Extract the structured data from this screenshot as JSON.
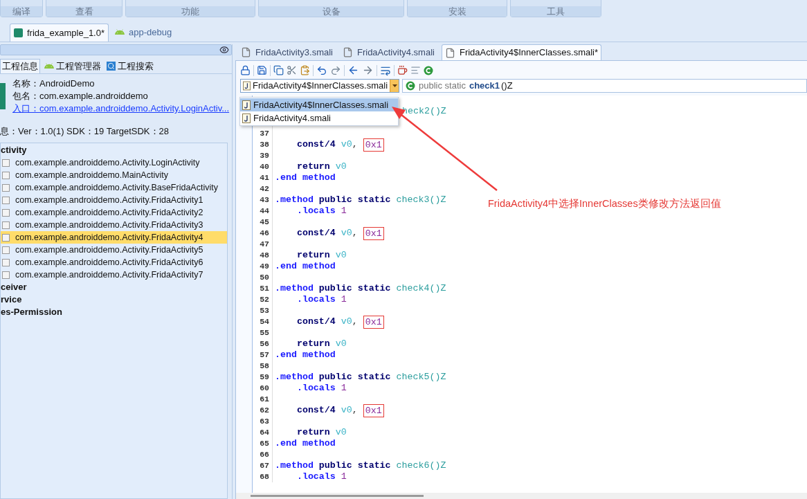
{
  "ribbon": {
    "groups": [
      {
        "label": "编译"
      },
      {
        "label": "查看"
      },
      {
        "label": "功能"
      },
      {
        "label": "设备"
      },
      {
        "label": "安装"
      },
      {
        "label": "工具"
      }
    ]
  },
  "project_tabs": [
    {
      "label": "frida_example_1.0*",
      "selected": true,
      "kind": "project"
    },
    {
      "label": "app-debug",
      "selected": false,
      "kind": "android"
    }
  ],
  "left_panel": {
    "tabs": [
      {
        "label": "工程信息",
        "selected": true
      },
      {
        "label": "工程管理器",
        "selected": false,
        "kind": "android"
      },
      {
        "label": "工程搜索",
        "selected": false,
        "kind": "search"
      }
    ],
    "info": {
      "name": "名称：AndroidDemo",
      "package": "包名：com.example.androiddemo",
      "entry": "入口：com.example.androiddemo.Activity.LoginActiv...",
      "version": "息：Ver：1.0(1) SDK：19 TargetSDK：28"
    },
    "tree": [
      {
        "label": "ctivity",
        "selected": false,
        "children": [
          {
            "label": "com.example.androiddemo.Activity.LoginActivity",
            "selected": false
          },
          {
            "label": "com.example.androiddemo.MainActivity",
            "selected": false
          },
          {
            "label": "com.example.androiddemo.Activity.BaseFridaActivity",
            "selected": false
          },
          {
            "label": "com.example.androiddemo.Activity.FridaActivity1",
            "selected": false
          },
          {
            "label": "com.example.androiddemo.Activity.FridaActivity2",
            "selected": false
          },
          {
            "label": "com.example.androiddemo.Activity.FridaActivity3",
            "selected": false
          },
          {
            "label": "com.example.androiddemo.Activity.FridaActivity4",
            "selected": true
          },
          {
            "label": "com.example.androiddemo.Activity.FridaActivity5",
            "selected": false
          },
          {
            "label": "com.example.androiddemo.Activity.FridaActivity6",
            "selected": false
          },
          {
            "label": "com.example.androiddemo.Activity.FridaActivity7",
            "selected": false
          }
        ]
      },
      {
        "label": "ceiver",
        "selected": false
      },
      {
        "label": "rvice",
        "selected": false
      },
      {
        "label": "es-Permission",
        "selected": false
      }
    ]
  },
  "editor": {
    "tabs": [
      {
        "label": "FridaActivity3.smali",
        "selected": false
      },
      {
        "label": "FridaActivity4.smali",
        "selected": false
      },
      {
        "label": "FridaActivity4$InnerClasses.smali*",
        "selected": true
      }
    ],
    "class_combo": {
      "value": "FridaActivity4$InnerClasses.smali"
    },
    "method_combo": {
      "modifiers": "public static",
      "name": "check1",
      "signature": "()Z"
    },
    "dropdown": {
      "items": [
        {
          "label": "FridaActivity4$InnerClasses.smali",
          "selected": true
        },
        {
          "label": "FridaActivity4.smali",
          "selected": false
        }
      ]
    },
    "lines": [
      {
        "cut": true,
        "tokens": [
          {
            "text": "heck2()Z",
            "kind": "name"
          }
        ]
      },
      {
        "n": "37"
      },
      {
        "n": "38",
        "tokens": [
          {
            "text": "    const/4 ",
            "kind": "keyword"
          },
          {
            "text": "v0",
            "kind": "register"
          },
          {
            "text": ", ",
            "kind": "plain"
          },
          {
            "text": "0x1",
            "kind": "number",
            "boxed": true
          }
        ]
      },
      {
        "n": "39"
      },
      {
        "n": "40",
        "tokens": [
          {
            "text": "    return ",
            "kind": "keyword"
          },
          {
            "text": "v0",
            "kind": "register"
          }
        ]
      },
      {
        "n": "41",
        "tokens": [
          {
            "text": ".end method",
            "kind": "directive"
          }
        ]
      },
      {
        "n": "42"
      },
      {
        "n": "43",
        "tokens": [
          {
            "text": ".method",
            "kind": "directive"
          },
          {
            "text": " public static ",
            "kind": "keyword"
          },
          {
            "text": "check3()Z",
            "kind": "name"
          }
        ]
      },
      {
        "n": "44",
        "tokens": [
          {
            "text": "    .locals ",
            "kind": "directive"
          },
          {
            "text": "1",
            "kind": "number"
          }
        ]
      },
      {
        "n": "45"
      },
      {
        "n": "46",
        "tokens": [
          {
            "text": "    const/4 ",
            "kind": "keyword"
          },
          {
            "text": "v0",
            "kind": "register"
          },
          {
            "text": ", ",
            "kind": "plain"
          },
          {
            "text": "0x1",
            "kind": "number",
            "boxed": true
          }
        ]
      },
      {
        "n": "47"
      },
      {
        "n": "48",
        "tokens": [
          {
            "text": "    return ",
            "kind": "keyword"
          },
          {
            "text": "v0",
            "kind": "register"
          }
        ]
      },
      {
        "n": "49",
        "tokens": [
          {
            "text": ".end method",
            "kind": "directive"
          }
        ]
      },
      {
        "n": "50"
      },
      {
        "n": "51",
        "tokens": [
          {
            "text": ".method",
            "kind": "directive"
          },
          {
            "text": " public static ",
            "kind": "keyword"
          },
          {
            "text": "check4()Z",
            "kind": "name"
          }
        ]
      },
      {
        "n": "52",
        "tokens": [
          {
            "text": "    .locals ",
            "kind": "directive"
          },
          {
            "text": "1",
            "kind": "number"
          }
        ]
      },
      {
        "n": "53"
      },
      {
        "n": "54",
        "tokens": [
          {
            "text": "    const/4 ",
            "kind": "keyword"
          },
          {
            "text": "v0",
            "kind": "register"
          },
          {
            "text": ", ",
            "kind": "plain"
          },
          {
            "text": "0x1",
            "kind": "number",
            "boxed": true
          }
        ]
      },
      {
        "n": "55"
      },
      {
        "n": "56",
        "tokens": [
          {
            "text": "    return ",
            "kind": "keyword"
          },
          {
            "text": "v0",
            "kind": "register"
          }
        ]
      },
      {
        "n": "57",
        "tokens": [
          {
            "text": ".end method",
            "kind": "directive"
          }
        ]
      },
      {
        "n": "58"
      },
      {
        "n": "59",
        "tokens": [
          {
            "text": ".method",
            "kind": "directive"
          },
          {
            "text": " public static ",
            "kind": "keyword"
          },
          {
            "text": "check5()Z",
            "kind": "name"
          }
        ]
      },
      {
        "n": "60",
        "tokens": [
          {
            "text": "    .locals ",
            "kind": "directive"
          },
          {
            "text": "1",
            "kind": "number"
          }
        ]
      },
      {
        "n": "61"
      },
      {
        "n": "62",
        "tokens": [
          {
            "text": "    const/4 ",
            "kind": "keyword"
          },
          {
            "text": "v0",
            "kind": "register"
          },
          {
            "text": ", ",
            "kind": "plain"
          },
          {
            "text": "0x1",
            "kind": "number",
            "boxed": true
          }
        ]
      },
      {
        "n": "63"
      },
      {
        "n": "64",
        "tokens": [
          {
            "text": "    return ",
            "kind": "keyword"
          },
          {
            "text": "v0",
            "kind": "register"
          }
        ]
      },
      {
        "n": "65",
        "tokens": [
          {
            "text": ".end method",
            "kind": "directive"
          }
        ]
      },
      {
        "n": "66"
      },
      {
        "n": "67",
        "tokens": [
          {
            "text": ".method",
            "kind": "directive"
          },
          {
            "text": " public static ",
            "kind": "keyword"
          },
          {
            "text": "check6()Z",
            "kind": "name"
          }
        ]
      },
      {
        "n": "68",
        "tokens": [
          {
            "text": "    .locals ",
            "kind": "directive"
          },
          {
            "text": "1",
            "kind": "number"
          }
        ]
      }
    ]
  },
  "annotation": {
    "text": "FridaActivity4中选择InnerClasses类修改方法返回值"
  }
}
